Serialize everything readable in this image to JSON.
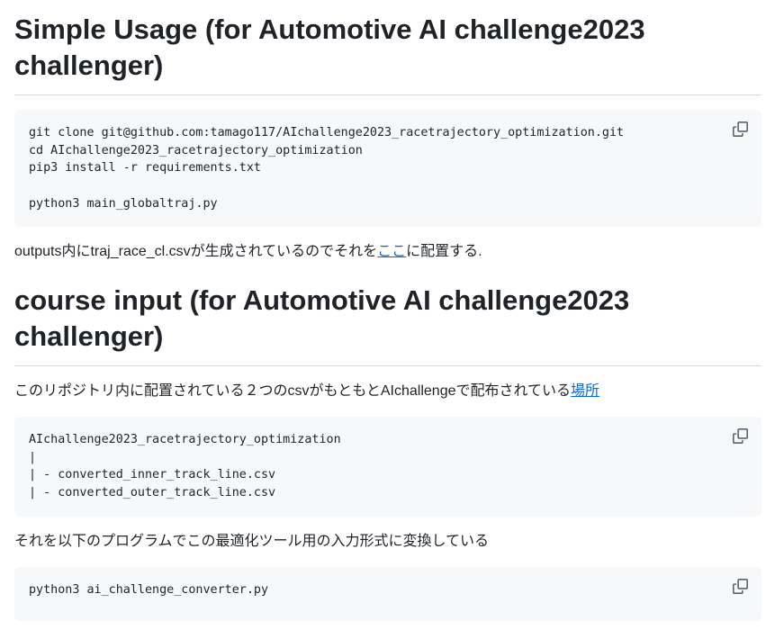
{
  "section1": {
    "heading": "Simple Usage (for Automotive AI challenge2023 challenger)",
    "code": "git clone git@github.com:tamago117/AIchallenge2023_racetrajectory_optimization.git\ncd AIchallenge2023_racetrajectory_optimization\npip3 install -r requirements.txt\n\npython3 main_globaltraj.py",
    "para_before": "outputs内にtraj_race_cl.csvが生成されているのでそれを",
    "link": "ここ",
    "para_after": "に配置する."
  },
  "section2": {
    "heading": "course input (for Automotive AI challenge2023 challenger)",
    "para1_before": "このリポジトリ内に配置されている２つのcsvがもともとAIchallengeで配布されている",
    "para1_link": "場所",
    "code1": "AIchallenge2023_racetrajectory_optimization\n|\n| - converted_inner_track_line.csv\n| - converted_outer_track_line.csv",
    "para2": "それを以下のプログラムでこの最適化ツール用の入力形式に変換している",
    "code2": "python3 ai_challenge_converter.py"
  },
  "icons": {
    "copy": "copy-icon"
  },
  "colors": {
    "text": "#1f2328",
    "link": "#0969da",
    "code_bg": "#f6f8fa",
    "border": "#d1d9e0",
    "icon": "#59636e"
  }
}
